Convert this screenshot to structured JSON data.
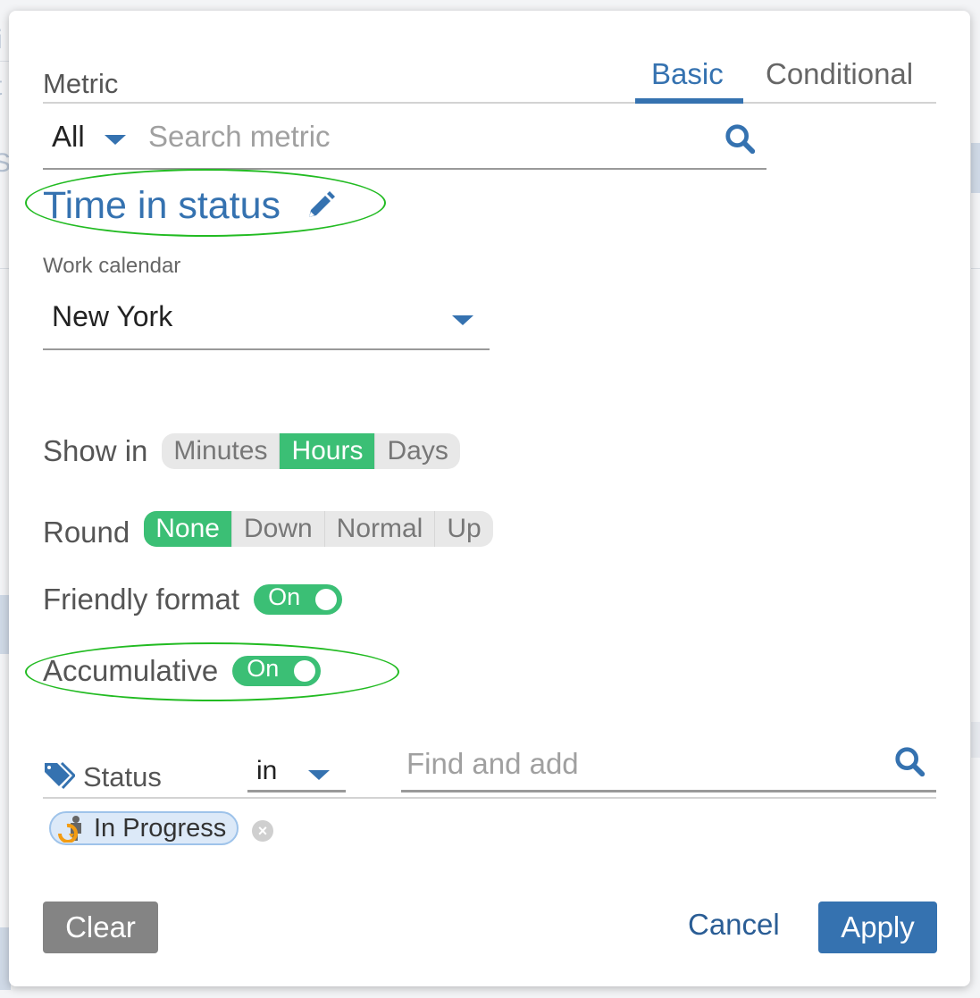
{
  "metric": {
    "label": "Metric",
    "tabs": [
      {
        "label": "Basic",
        "active": true
      },
      {
        "label": "Conditional",
        "active": false
      }
    ],
    "filter_select": "All",
    "search_placeholder": "Search metric",
    "search_value": "",
    "selected_title": "Time in status"
  },
  "work_calendar": {
    "label": "Work calendar",
    "value": "New York"
  },
  "show_in": {
    "label": "Show in",
    "options": [
      "Minutes",
      "Hours",
      "Days"
    ],
    "selected": "Hours"
  },
  "round": {
    "label": "Round",
    "options": [
      "None",
      "Down",
      "Normal",
      "Up"
    ],
    "selected": "None"
  },
  "friendly_format": {
    "label": "Friendly format",
    "toggle_text": "On",
    "enabled": true
  },
  "accumulative": {
    "label": "Accumulative",
    "toggle_text": "On",
    "enabled": true
  },
  "status_filter": {
    "label": "Status",
    "operator": "in",
    "find_placeholder": "Find and add",
    "find_value": "",
    "chips": [
      {
        "label": "In Progress"
      }
    ]
  },
  "actions": {
    "clear": "Clear",
    "cancel": "Cancel",
    "apply": "Apply"
  },
  "colors": {
    "accent": "#3572b0",
    "active_green": "#3bbf75",
    "highlight_annotation": "#22bb22"
  }
}
